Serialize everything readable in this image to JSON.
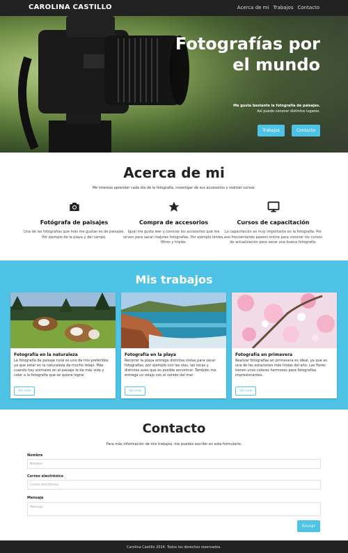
{
  "navbar": {
    "brand": "CAROLINA CASTILLO",
    "links": [
      "Acerca de mi",
      "Trabajos",
      "Contacto"
    ]
  },
  "hero": {
    "title_line1": "Fotografías por",
    "title_line2": "el mundo",
    "subtitle_line1": "Me gusta bastante la fotografía de paisajes.",
    "subtitle_line2": "Así puedo conocer distintos lugares.",
    "button_works": "Trabajos",
    "button_contact": "Contacto"
  },
  "about": {
    "title": "Acerca de mi",
    "lead": "Me interesa aprender cada día de la fotografía, investigar de sus accesorios y realizar cursos.",
    "features": [
      {
        "icon": "camera-icon",
        "title": "Fotógrafa de paisajes",
        "text": "Una de las fotografías que más me gustan es de paisajes. Por ejemplo de la playa y del campo."
      },
      {
        "icon": "star-icon",
        "title": "Compra de accesorios",
        "text": "Igual me gusta leer y conocer los accesorios que me sirven para sacar mejores fotografías. Por ejemplo lentes, filtros y tripiés."
      },
      {
        "icon": "monitor-icon",
        "title": "Cursos de capacitación",
        "text": "Lo capacitación es muy importante en la fotografía. Por eso frecuentando paseos online para conocer los cursos de actualización para sacar una buena fotografía."
      }
    ]
  },
  "works": {
    "title": "Mis trabajos",
    "cards": [
      {
        "title": "Fotografía en la naturaleza",
        "text": "La fotografía de paisaje rural es uno de mis preferidos ya que estar en la naturaleza da mucho relajo. Más cuando hay animales en el paisaje le da más vida y color a la fotografía que se quiere lograr.",
        "button": "Ver más"
      },
      {
        "title": "Fotografía en la playa",
        "text": "Recorrer la playa entrega distintas vistas para sacar fotografías, por ejemplo con las olas, las rocas y distintas aves que es posible encontrar. También me entrega un relajo con el sonido del mar.",
        "button": "Ver más"
      },
      {
        "title": "Fotografía en primavera",
        "text": "Realizar fotografías en primavera es ideal, ya que es una de las estaciones más lindas del año. Las flores tienen unos colores hermosos para fotografías impresionantes.",
        "button": "Ver más"
      }
    ]
  },
  "contact": {
    "title": "Contacto",
    "lead": "Para más información de mis trabajos, me puedes escribir en este formulario.",
    "name_label": "Nombre",
    "name_placeholder": "Nombre",
    "email_label": "Correo electrónico",
    "email_placeholder": "Correo electrónico",
    "message_label": "Mensaje",
    "message_placeholder": "Mensaje",
    "send_button": "Enviar"
  },
  "footer": {
    "text": "Carolina Castillo 2024. Todos los derechos reservados."
  },
  "colors": {
    "accent": "#4ec3e6",
    "navbar": "#222222"
  }
}
